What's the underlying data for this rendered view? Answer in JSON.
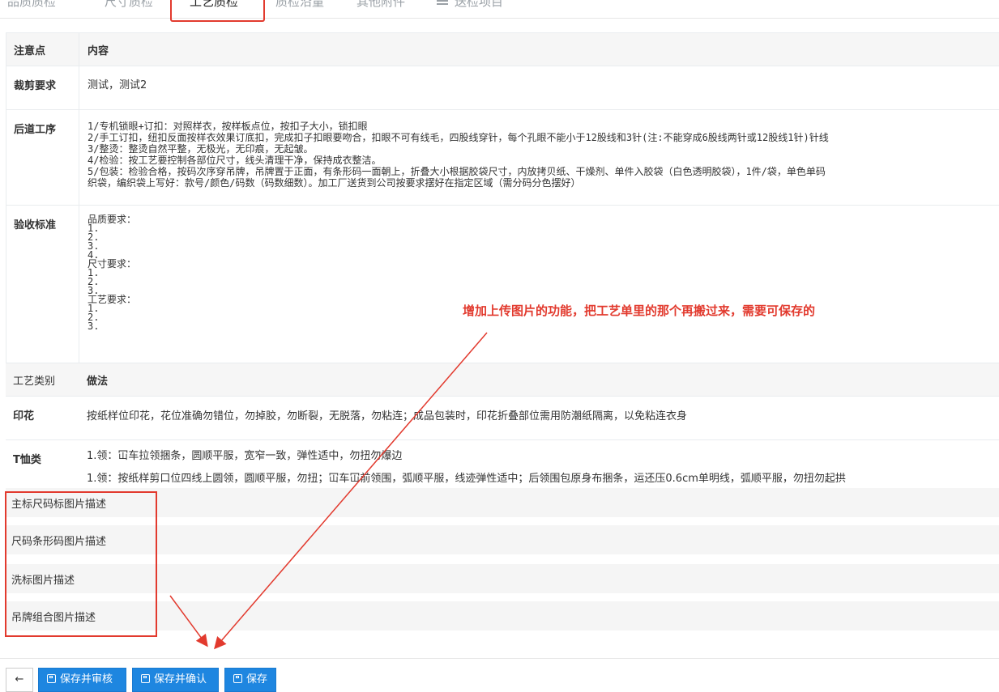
{
  "tabs": [
    "品质质检",
    "尺寸质检",
    "工艺质检",
    "质检沿量",
    "其他附件",
    "送检项目"
  ],
  "active_tab": "工艺质检",
  "notes_table": {
    "header": {
      "key": "注意点",
      "value": "内容"
    },
    "rows": [
      {
        "key": "裁剪要求",
        "lines": [
          "测试，测试2"
        ]
      },
      {
        "key": "后道工序",
        "lines": [
          "1/专机锁眼+订扣：对照样衣，按样板点位，按扣子大小，锁扣眼",
          "2/手工订扣，纽扣反面按样衣效果订底扣，完成扣子扣眼要吻合，扣眼不可有线毛，四股线穿针，每个孔眼不能小于12股线和3针(注:不能穿成6股线两针或12股线1针)针线",
          "3/整烫：整烫自然平整，无极光，无印痕，无起皱。",
          "4/检验：按工艺要控制各部位尺寸，线头清理干净，保持成衣整洁。",
          "5/包装：检验合格，按码次序穿吊牌，吊牌置于正面，有条形码一面朝上，折叠大小根据胶袋尺寸，内放拷贝纸、干燥剂、单件入胶袋（白色透明胶袋），1件/袋，单色单码",
          "织袋，编织袋上写好：款号/颜色/码数（码数细数）。加工厂送货到公司按要求摆好在指定区域（需分码分色摆好）"
        ]
      },
      {
        "key": "验收标准",
        "lines": [
          "品质要求：",
          "1.",
          "2.",
          "3.",
          "4.",
          "尺寸要求：",
          "1.",
          "2.",
          "3.",
          "工艺要求：",
          "1.",
          "2.",
          "3."
        ]
      }
    ]
  },
  "method_table": {
    "header": {
      "key": "工艺类别",
      "value": "做法"
    },
    "rows": [
      {
        "key": "印花",
        "lines": [
          "按纸样位印花，花位准确勿错位，勿掉胶，勿断裂，无脱落，勿粘连；成品包装时，印花折叠部位需用防潮纸隔离，以免粘连衣身"
        ]
      },
      {
        "key": "T恤类",
        "lines": [
          "1.领：冚车拉领捆条，圆顺平服，宽窄一致，弹性适中，勿扭勿爆边",
          "1.领：按纸样剪口位四线上圆领，圆顺平服，勿扭；冚车冚前领围，弧顺平服，线迹弹性适中；后领围包原身布捆条，运还压0.6cm单明线，弧顺平服，勿扭勿起拱"
        ]
      }
    ]
  },
  "image_descriptions": [
    "主标尺码标图片描述",
    "尺码条形码图片描述",
    "洗标图片描述",
    "吊牌组合图片描述"
  ],
  "annotation": {
    "text": "增加上传图片的功能，把工艺单里的那个再搬过来，需要可保存的",
    "color": "#e23a2e"
  },
  "toolbar": {
    "back_icon": "←",
    "save_and_review": "保存并审核",
    "save_and_confirm": "保存并确认",
    "save": "保存"
  },
  "colors": {
    "primary": "#1e86e0",
    "annotation": "#e23a2e"
  }
}
